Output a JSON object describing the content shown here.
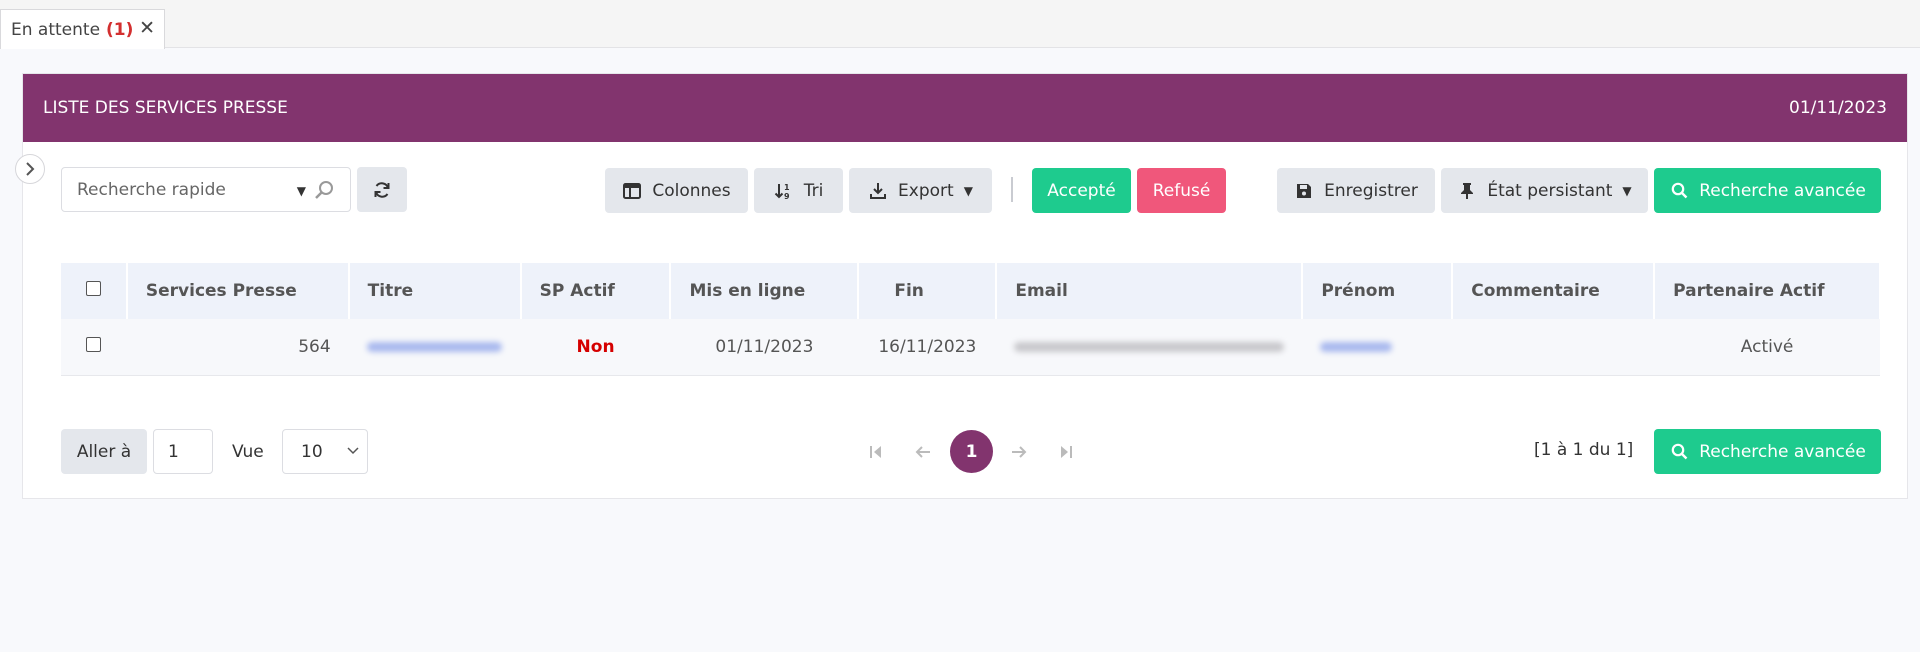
{
  "tab": {
    "label": "En attente",
    "count": "(1)",
    "close": "✕"
  },
  "header": {
    "title": "LISTE DES SERVICES PRESSE",
    "date": "01/11/2023"
  },
  "toolbar": {
    "search_placeholder": "Recherche rapide",
    "columns_label": "Colonnes",
    "sort_label": "Tri",
    "export_label": "Export",
    "accept_label": "Accepté",
    "refuse_label": "Refusé",
    "save_label": "Enregistrer",
    "persist_label": "État persistant",
    "advanced_search_label": "Recherche avancée"
  },
  "table": {
    "headers": [
      "Services Presse",
      "Titre",
      "SP Actif",
      "Mis en ligne",
      "Fin",
      "Email",
      "Prénom",
      "Commentaire",
      "Partenaire Actif"
    ],
    "rows": [
      {
        "id": "564",
        "sp_actif": "Non",
        "mis_en_ligne": "01/11/2023",
        "fin": "16/11/2023",
        "commentaire": "",
        "partenaire_actif": "Activé"
      }
    ]
  },
  "pagination": {
    "goto_label": "Aller à",
    "goto_value": "1",
    "view_label": "Vue",
    "view_value": "10",
    "current_page": "1",
    "range_text": "[1 à 1 du 1]",
    "advanced_search_label": "Recherche avancée"
  },
  "colors": {
    "brand": "#82346e",
    "accept": "#1ecb8e",
    "refuse": "#f0577b",
    "status_non": "#d50000"
  }
}
